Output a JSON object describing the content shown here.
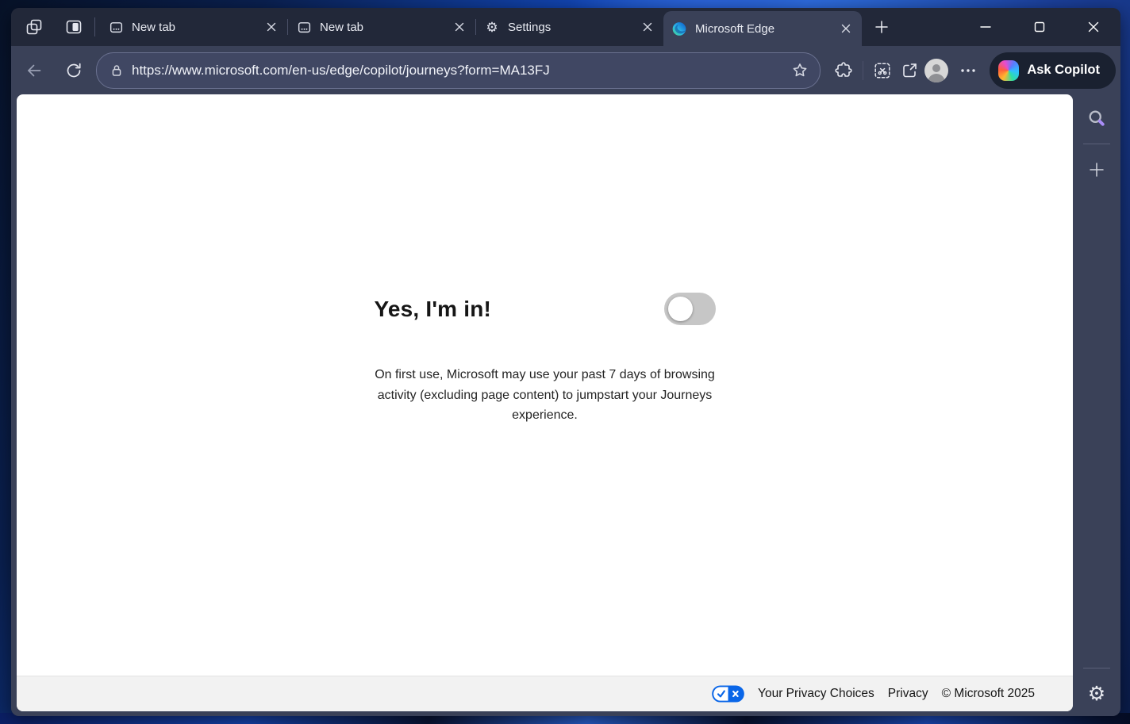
{
  "browser": {
    "tabs": [
      {
        "label": "New tab"
      },
      {
        "label": "New tab"
      },
      {
        "label": "Settings"
      },
      {
        "label": "Microsoft Edge",
        "active": true
      }
    ],
    "address": {
      "url": "https://www.microsoft.com/en-us/edge/copilot/journeys?form=MA13FJ"
    },
    "copilot_label": "Ask Copilot"
  },
  "page": {
    "heading": "Yes, I'm in!",
    "toggle_state": "off",
    "description": "On first use, Microsoft may use your past 7 days of browsing activity (excluding page content) to jumpstart your Journeys experience.",
    "footer": {
      "privacy_choices_label": "Your Privacy Choices",
      "privacy_label": "Privacy",
      "copyright": "© Microsoft 2025"
    }
  },
  "icons": {
    "gear_glyph": "⚙"
  },
  "colors": {
    "chrome_dark": "#222839",
    "chrome_light": "#3A4158",
    "address_pill": "#404763",
    "copilot_pill": "#1a2130",
    "content_bg": "#ffffff",
    "footer_bg": "#f2f2f2",
    "toggle_off_track": "#c6c6c6",
    "privacy_icon_blue": "#0a66e8",
    "wallpaper_blue": "#2f6fe0"
  }
}
